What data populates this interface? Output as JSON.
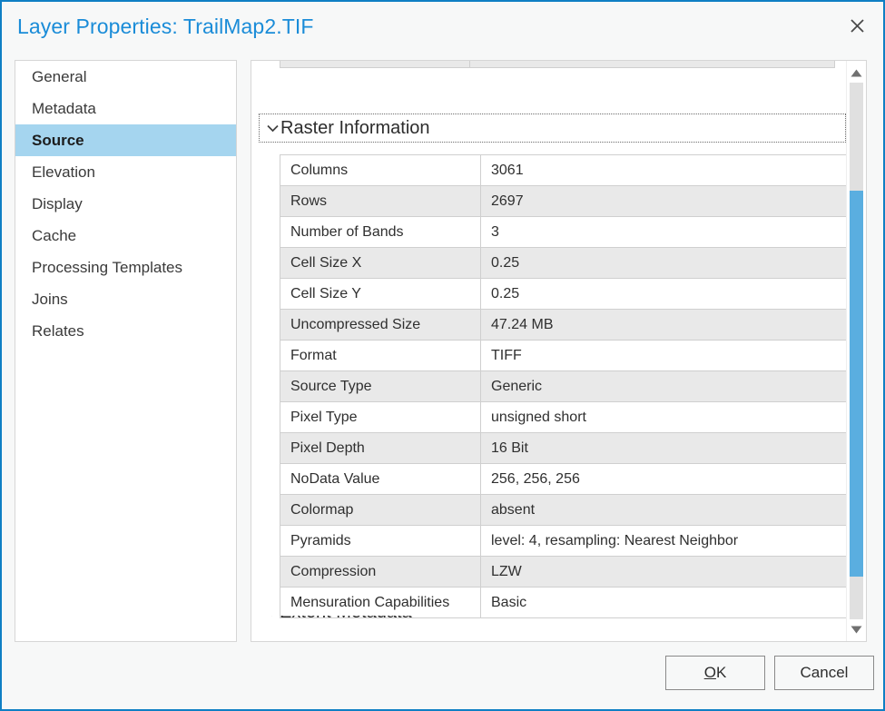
{
  "window": {
    "title": "Layer Properties: TrailMap2.TIF",
    "close_icon": "close-icon",
    "accent_color": "#0f7fc4",
    "title_color": "#1a8cd8"
  },
  "sidebar": {
    "items": [
      {
        "label": "General",
        "selected": false
      },
      {
        "label": "Metadata",
        "selected": false
      },
      {
        "label": "Source",
        "selected": true
      },
      {
        "label": "Elevation",
        "selected": false
      },
      {
        "label": "Display",
        "selected": false
      },
      {
        "label": "Cache",
        "selected": false
      },
      {
        "label": "Processing Templates",
        "selected": false
      },
      {
        "label": "Joins",
        "selected": false
      },
      {
        "label": "Relates",
        "selected": false
      }
    ],
    "selected_color": "#a5d5ef"
  },
  "content": {
    "clipped_top_row": {
      "key": "",
      "value": "..."
    },
    "section": {
      "title": "Raster Information",
      "expanded": true,
      "chevron_icon": "chevron-down-icon"
    },
    "table": {
      "rows": [
        {
          "key": "Columns",
          "value": "3061"
        },
        {
          "key": "Rows",
          "value": "2697"
        },
        {
          "key": "Number of Bands",
          "value": "3"
        },
        {
          "key": "Cell Size X",
          "value": "0.25"
        },
        {
          "key": "Cell Size Y",
          "value": "0.25"
        },
        {
          "key": "Uncompressed Size",
          "value": "47.24 MB"
        },
        {
          "key": "Format",
          "value": "TIFF"
        },
        {
          "key": "Source Type",
          "value": "Generic"
        },
        {
          "key": "Pixel Type",
          "value": "unsigned short"
        },
        {
          "key": "Pixel Depth",
          "value": "16 Bit"
        },
        {
          "key": "NoData Value",
          "value": "256, 256, 256"
        },
        {
          "key": "Colormap",
          "value": "absent"
        },
        {
          "key": "Pyramids",
          "value": "level: 4, resampling: Nearest Neighbor"
        },
        {
          "key": "Compression",
          "value": "LZW"
        },
        {
          "key": "Mensuration Capabilities",
          "value": "Basic"
        }
      ]
    },
    "clipped_bottom_section": {
      "title": "Extent Metadata",
      "chevron_icon": "chevron-down-icon"
    },
    "scrollbar": {
      "up_icon": "scroll-up-arrow-icon",
      "down_icon": "scroll-down-arrow-icon",
      "thumb_color": "#5aaee0"
    }
  },
  "footer": {
    "ok_label_accel": "O",
    "ok_label_rest": "K",
    "cancel_label": "Cancel"
  }
}
